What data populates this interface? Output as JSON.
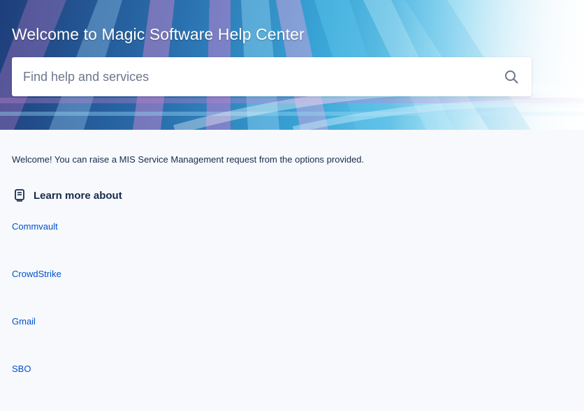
{
  "header": {
    "title": "Welcome to Magic Software Help Center"
  },
  "search": {
    "placeholder": "Find help and services",
    "icon": "search-icon"
  },
  "intro": {
    "text": "Welcome! You can raise a MIS Service Management request from the options provided."
  },
  "learn_more": {
    "icon": "knowledge-base-icon",
    "title": "Learn more about",
    "topics": [
      {
        "label": "Commvault"
      },
      {
        "label": "CrowdStrike"
      },
      {
        "label": "Gmail"
      },
      {
        "label": "SBO"
      }
    ]
  },
  "colors": {
    "link": "#0052cc",
    "text": "#172b4d",
    "page_bg": "#f7f9fc"
  }
}
